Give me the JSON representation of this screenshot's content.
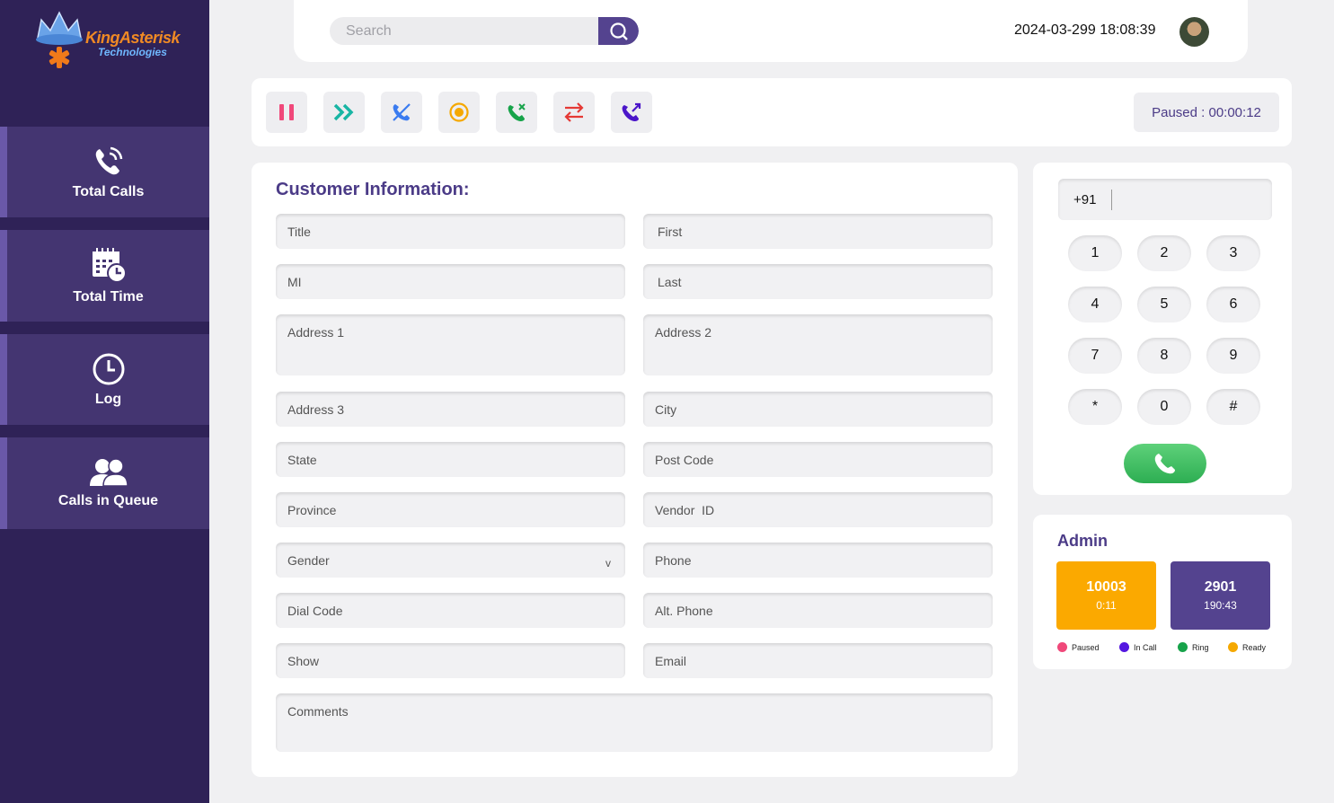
{
  "brand": {
    "name": "KingAsterisk",
    "tagline": "Technologies"
  },
  "sidebar": {
    "items": [
      {
        "label": "Total Calls",
        "icon": "phone-ringing-icon"
      },
      {
        "label": "Total Time",
        "icon": "calendar-clock-icon"
      },
      {
        "label": "Log",
        "icon": "clock-icon"
      },
      {
        "label": "Calls in Queue",
        "icon": "users-icon"
      }
    ]
  },
  "header": {
    "search_placeholder": "Search",
    "datetime": "2024-03-299 18:08:39"
  },
  "toolbar": {
    "buttons": [
      {
        "icon": "pause-icon",
        "color": "#f0487a"
      },
      {
        "icon": "fast-forward-icon",
        "color": "#18b5a4"
      },
      {
        "icon": "mute-call-icon",
        "color": "#3a7bf0"
      },
      {
        "icon": "record-icon",
        "color": "#f5a800"
      },
      {
        "icon": "call-end-icon",
        "color": "#17a34a"
      },
      {
        "icon": "transfer-icon",
        "color": "#e53935"
      },
      {
        "icon": "outgoing-call-icon",
        "color": "#4b16c9"
      }
    ],
    "status": "Paused : 00:00:12"
  },
  "customer": {
    "title": "Customer Information:",
    "fields": {
      "title": "Title",
      "first": "First",
      "mi": "MI",
      "last": "Last",
      "address1": "Address 1",
      "address2": "Address 2",
      "address3": "Address 3",
      "city": "City",
      "state": "State",
      "postcode": "Post Code",
      "province": "Province",
      "vendor_id": "Vendor  ID",
      "gender": "Gender",
      "phone": "Phone",
      "dial_code": "Dial Code",
      "alt_phone": "Alt. Phone",
      "show": "Show",
      "email": "Email",
      "comments": "Comments"
    },
    "gender_caret": "v"
  },
  "dialer": {
    "country_code": "+91",
    "keys": [
      "1",
      "2",
      "3",
      "4",
      "5",
      "6",
      "7",
      "8",
      "9",
      "*",
      "0",
      "#"
    ]
  },
  "admin": {
    "title": "Admin",
    "stats": [
      {
        "value": "10003",
        "sub": "0:11",
        "color": "#fba900"
      },
      {
        "value": "2901",
        "sub": "190:43",
        "color": "#54438f"
      }
    ],
    "legend": [
      {
        "label": "Paused",
        "color": "#f0487a"
      },
      {
        "label": "In Call",
        "color": "#5417e0"
      },
      {
        "label": "Ring",
        "color": "#17a34a"
      },
      {
        "label": "Ready",
        "color": "#f5a800"
      }
    ]
  }
}
